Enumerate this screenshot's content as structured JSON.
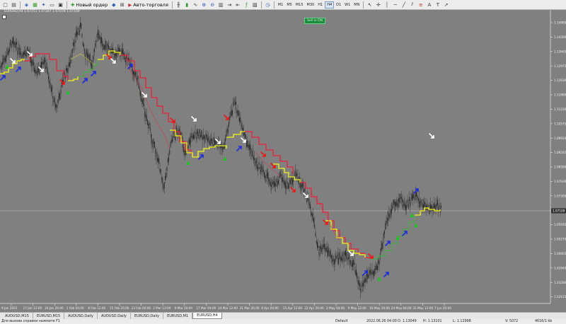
{
  "toolbar": {
    "new_order_label": "Новый ордер",
    "autotrading_label": "Авто-торговля",
    "timeframes": [
      "M1",
      "M5",
      "M15",
      "M30",
      "H1",
      "H4",
      "D1",
      "W1",
      "MN"
    ],
    "active_timeframe": "H4"
  },
  "chart": {
    "title": "EURUSD,H4  1.07251 1.07287 1.07078 1.07109",
    "signal_badge": "Sell in ON",
    "current_price": "1.07109",
    "price_labels": [
      "1.14960",
      "1.14300",
      "1.13645",
      "1.12975",
      "1.12630",
      "1.11960",
      "1.11220",
      "1.10575",
      "1.09910",
      "1.09245",
      "1.08580",
      "1.07930",
      "1.07265",
      "1.06600",
      "1.05935",
      "1.05270",
      "1.04605",
      "1.03940",
      "1.03280",
      "1.02615"
    ],
    "time_labels": [
      "9 Jan 2022",
      "17 Jan 12:00",
      "24 Jan 20:00",
      "1 Feb 04:00",
      "8 Feb 12:00",
      "15 Feb 20:00",
      "23 Feb 04:00",
      "2 Mar 12:00",
      "9 Mar 20:00",
      "17 Mar 04:00",
      "24 Mar 12:00",
      "31 Mar 20:00",
      "8 Apr 04:00",
      "15 Apr 12:00",
      "22 Apr 20:00",
      "2 May 04:00",
      "9 May 12:00",
      "16 May 20:00",
      "24 May 04:00",
      "31 May 12:00",
      "7 Jun 20:00"
    ],
    "colors": {
      "background": "#808080",
      "candles": "#2a2a2a",
      "trend_down": "#e8223a",
      "trend_up": "#f4f418",
      "trend_up_secondary": "#1ec81e",
      "arrow_sell": "#ffffff",
      "arrow_sell_alt": "#e81818",
      "arrow_buy": "#1a2cd8",
      "arrow_buy_alt": "#18c818"
    }
  },
  "tabs": [
    "AUDUSD,M15",
    "EURUSD,M15",
    "AUDUSD,Daily",
    "AUDUSD,Daily",
    "EURUSD,Daily",
    "EURUSD,M1",
    "EURUSD,H4"
  ],
  "active_tab": "EURUSD,H4",
  "status": {
    "help": "Для вызова справки нажмите F1",
    "profile": "Default",
    "datetime": "2022.06.26 04:00",
    "high": "H: 1.13101",
    "low": "L: 1.12998",
    "open": "O: 1.13049",
    "volume": "V: 5072",
    "traffic": "4616/1 kb"
  }
}
